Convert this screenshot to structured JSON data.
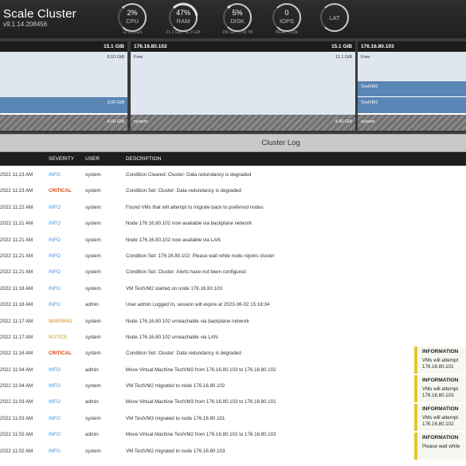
{
  "app": {
    "title": "Scale Cluster",
    "version": "v9.1.14.208456"
  },
  "gauges": [
    {
      "id": "cpu",
      "value": "2%",
      "label": "CPU",
      "sub": "12 CORES",
      "fill": 0.02
    },
    {
      "id": "ram",
      "value": "47%",
      "label": "RAM",
      "sub": "21.2 GiB / 45.3 GiB",
      "fill": 0.47
    },
    {
      "id": "disk",
      "value": "5%",
      "label": "DISK",
      "sub": "155 GB / 2.90 TB",
      "fill": 0.05
    },
    {
      "id": "iops",
      "value": "0",
      "label": "IOPS",
      "sub": "PEAK: 1.83k",
      "fill": 0
    },
    {
      "id": "lat",
      "value": "",
      "label": "LAT",
      "sub": "",
      "fill": 0
    }
  ],
  "colors": {
    "gauge_ring": "#c9c9c9",
    "gauge_track": "#555555",
    "gauge_fill": "#e2e2e2",
    "vm_block": "#5a86b5",
    "notice_accent": "#e0c832"
  },
  "nodes": [
    {
      "name": "",
      "size": "15.1 GiB",
      "free_label": "",
      "free_value": "8.10 GiB",
      "vms": [
        {
          "name": "",
          "value": "3.00 GiB"
        }
      ],
      "system_label": "",
      "system_value": "4.00 GiB"
    },
    {
      "name": "176.16.80.102",
      "size": "15.1 GiB",
      "free_label": "Free",
      "free_value": "11.1 GiB",
      "vms": [],
      "system_label": "system",
      "system_value": "4.00 GiB"
    },
    {
      "name": "176.16.80.103",
      "size": "",
      "free_label": "Free",
      "free_value": "",
      "vms": [
        {
          "name": "TestVM2",
          "value": ""
        },
        {
          "name": "TestVM1",
          "value": ""
        }
      ],
      "system_label": "system",
      "system_value": ""
    }
  ],
  "log": {
    "title": "Cluster Log",
    "columns": {
      "severity": "SEVERITY",
      "user": "USER",
      "description": "DESCRIPTION"
    },
    "rows": [
      {
        "time": "2022 11:23 AM",
        "severity": "INFO",
        "user": "system",
        "description": "Condition Cleared: Cluster: Data redundancy is degraded"
      },
      {
        "time": "2022 11:23 AM",
        "severity": "CRITICAL",
        "user": "system",
        "description": "Condition Set: Cluster: Data redundancy is degraded"
      },
      {
        "time": "2022 11:22 AM",
        "severity": "INFO",
        "user": "system",
        "description": "Found VMs that will attempt to migrate back to preferred nodes"
      },
      {
        "time": "2022 11:21 AM",
        "severity": "INFO",
        "user": "system",
        "description": "Node 176.16.80.102 now available via backplane network"
      },
      {
        "time": "2022 11:21 AM",
        "severity": "INFO",
        "user": "system",
        "description": "Node 176.16.80.102 now available via LAN"
      },
      {
        "time": "2022 11:21 AM",
        "severity": "INFO",
        "user": "system",
        "description": "Condition Set: 176.16.80.102: Please wait while node rejoins cluster"
      },
      {
        "time": "2022 11:21 AM",
        "severity": "INFO",
        "user": "system",
        "description": "Condition Set: Cluster: Alerts have not been configured"
      },
      {
        "time": "2022 11:18 AM",
        "severity": "INFO",
        "user": "system",
        "description": "VM TestVM2 started on node 176.16.80.103"
      },
      {
        "time": "2022 11:18 AM",
        "severity": "INFO",
        "user": "admin",
        "description": "User admin Logged In, session will expire at 2023-06-02 15:18:34"
      },
      {
        "time": "2022 11:17 AM",
        "severity": "WARNING",
        "user": "system",
        "description": "Node 176.16.80.102 unreachable via backplane network"
      },
      {
        "time": "2022 11:17 AM",
        "severity": "NOTICE",
        "user": "system",
        "description": "Node 176.16.80.102 unreachable via LAN"
      },
      {
        "time": "2022 11:16 AM",
        "severity": "CRITICAL",
        "user": "system",
        "description": "Condition Set: Cluster: Data redundancy is degraded"
      },
      {
        "time": "2022 11:04 AM",
        "severity": "INFO",
        "user": "admin",
        "description": "Move Virtual Machine TestVM2 from 176.16.80.103 to 176.16.80.102"
      },
      {
        "time": "2022 11:04 AM",
        "severity": "INFO",
        "user": "system",
        "description": "VM TestVM2 migrated to node 176.16.80.102"
      },
      {
        "time": "2022 11:03 AM",
        "severity": "INFO",
        "user": "admin",
        "description": "Move Virtual Machine TestVM3 from 176.16.80.103 to 176.16.80.101"
      },
      {
        "time": "2022 11:03 AM",
        "severity": "INFO",
        "user": "system",
        "description": "VM TestVM3 migrated to node 176.16.80.101"
      },
      {
        "time": "2022 11:02 AM",
        "severity": "INFO",
        "user": "admin",
        "description": "Move Virtual Machine TestVM2 from 176.16.80.102 to 176.16.80.103"
      },
      {
        "time": "2022 11:02 AM",
        "severity": "INFO",
        "user": "system",
        "description": "VM TestVM2 migrated to node 176.16.80.103"
      }
    ]
  },
  "notifications": [
    {
      "title": "INFORMATION",
      "body": "VMs will attempt 176.16.80.101"
    },
    {
      "title": "INFORMATION",
      "body": "VMs will attempt 176.16.80.103"
    },
    {
      "title": "INFORMATION",
      "body": "VMs will attempt 176.16.80.102"
    },
    {
      "title": "INFORMATION",
      "body": "Please wait while"
    }
  ]
}
